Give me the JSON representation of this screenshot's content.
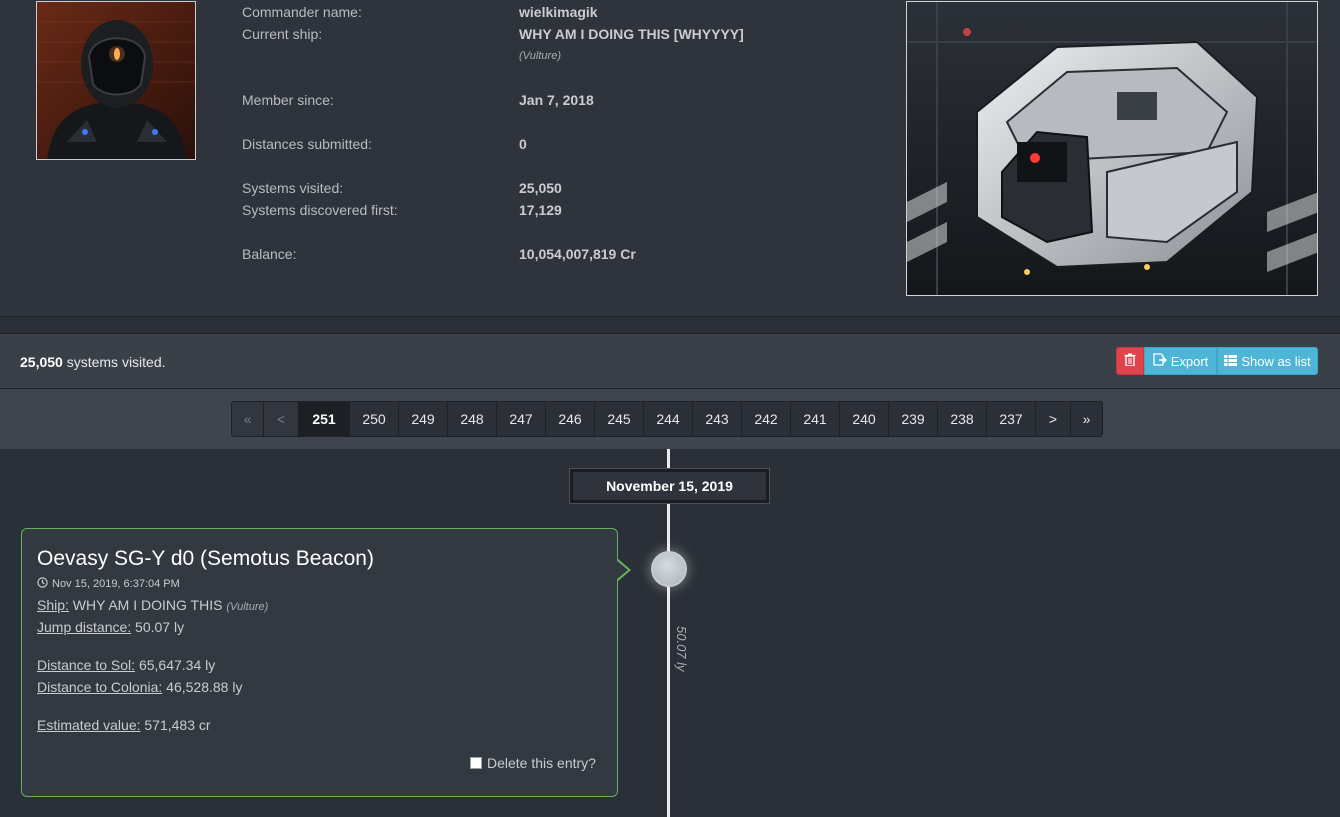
{
  "profile": {
    "commander_name_label": "Commander name:",
    "commander_name": "wielkimagik",
    "current_ship_label": "Current ship:",
    "current_ship": "WHY AM I DOING THIS [WHYYYY]",
    "current_ship_type": "(Vulture)",
    "member_since_label": "Member since:",
    "member_since": "Jan 7, 2018",
    "distances_submitted_label": "Distances submitted:",
    "distances_submitted": "0",
    "systems_visited_label": "Systems visited:",
    "systems_visited": "25,050",
    "systems_discovered_label": "Systems discovered first:",
    "systems_discovered": "17,129",
    "balance_label": "Balance:",
    "balance": "10,054,007,819 Cr"
  },
  "list_header": {
    "count": "25,050",
    "count_suffix": " systems visited.",
    "export_label": "Export",
    "show_as_list_label": "Show as list"
  },
  "pagination": {
    "first": "«",
    "prev": "<",
    "pages": [
      "251",
      "250",
      "249",
      "248",
      "247",
      "246",
      "245",
      "244",
      "243",
      "242",
      "241",
      "240",
      "239",
      "238",
      "237"
    ],
    "active_page": "251",
    "next": ">",
    "last": "»"
  },
  "timeline": {
    "date": "November 15, 2019",
    "jump_label": "50.07 ly"
  },
  "entry": {
    "system_name": "Oevasy SG-Y d0 (Semotus Beacon)",
    "timestamp": "Nov 15, 2019, 6:37:04 PM",
    "ship_label": "Ship:",
    "ship_name": " WHY AM I DOING THIS ",
    "ship_type": "(Vulture)",
    "jump_distance_label": "Jump distance:",
    "jump_distance": " 50.07 ly",
    "distance_sol_label": "Distance to Sol:",
    "distance_sol": " 65,647.34 ly",
    "distance_colonia_label": "Distance to Colonia:",
    "distance_colonia": " 46,528.88 ly",
    "estimated_value_label": "Estimated value:",
    "estimated_value": " 571,483 cr",
    "delete_label": "Delete this entry?"
  },
  "colors": {
    "accent_info": "#4db6d6",
    "accent_danger": "#e0434b",
    "card_border": "#64b25f"
  },
  "icons": {
    "delete": "trash-icon",
    "export": "export-icon",
    "list": "list-icon",
    "time": "clock-icon"
  }
}
